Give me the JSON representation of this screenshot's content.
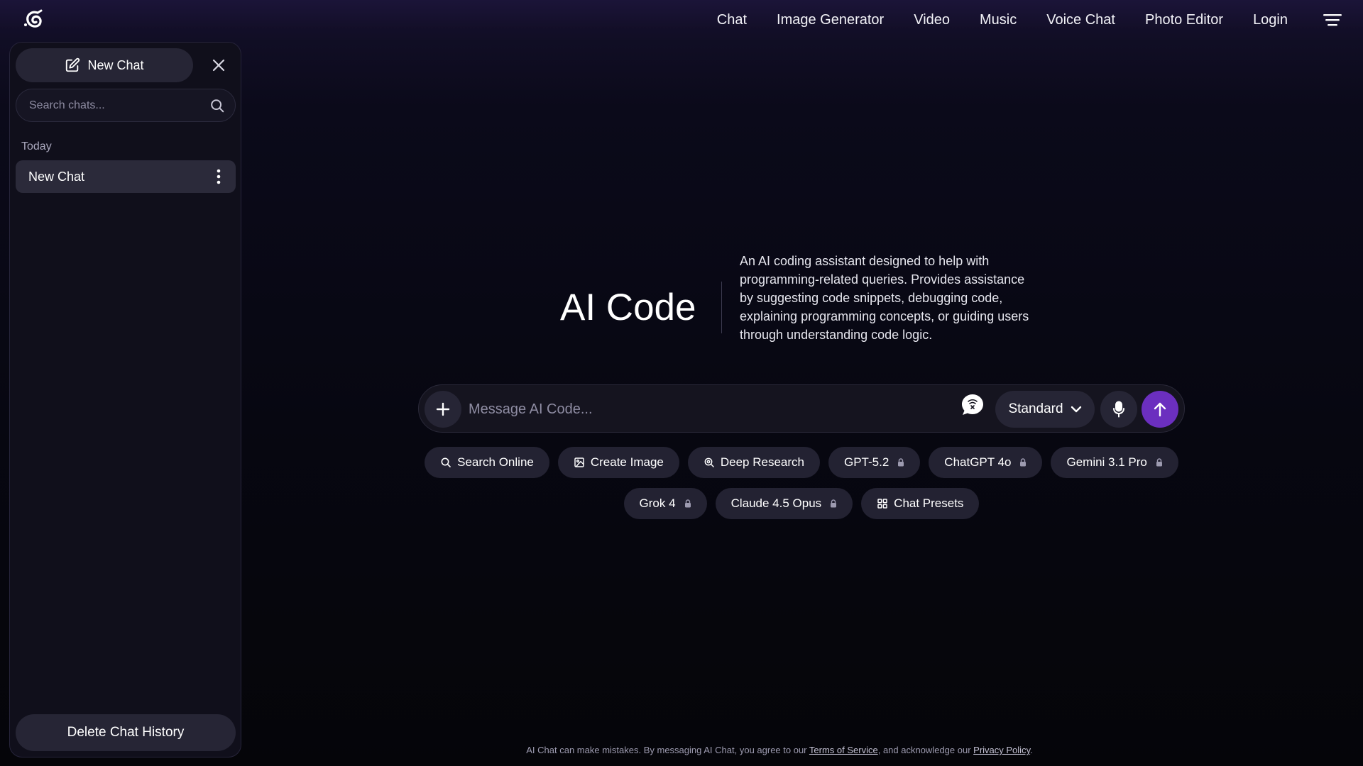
{
  "nav": {
    "items": [
      "Chat",
      "Image Generator",
      "Video",
      "Music",
      "Voice Chat",
      "Photo Editor",
      "Login"
    ]
  },
  "sidebar": {
    "new_chat_label": "New Chat",
    "search_placeholder": "Search chats...",
    "section_label": "Today",
    "chats": [
      "New Chat"
    ],
    "delete_label": "Delete Chat History"
  },
  "hero": {
    "title": "AI Code",
    "description": "An AI coding assistant designed to help with programming-related queries. Provides assistance by suggesting code snippets, debugging code, explaining programming concepts, or guiding users through understanding code logic."
  },
  "composer": {
    "placeholder": "Message AI Code...",
    "mode": "Standard"
  },
  "chips": {
    "search_online": "Search Online",
    "create_image": "Create Image",
    "deep_research": "Deep Research",
    "gpt52": "GPT-5.2",
    "chatgpt4o": "ChatGPT 4o",
    "gemini": "Gemini 3.1 Pro",
    "grok": "Grok 4",
    "claude": "Claude 4.5 Opus",
    "presets": "Chat Presets"
  },
  "footer": {
    "text_before": "AI Chat can make mistakes. By messaging AI Chat, you agree to our ",
    "terms": "Terms of Service",
    "text_middle": ", and acknowledge our ",
    "privacy": "Privacy Policy",
    "text_after": "."
  },
  "colors": {
    "accent": "#6b2fbf",
    "background": "#070711",
    "panel": "#100f1b"
  }
}
